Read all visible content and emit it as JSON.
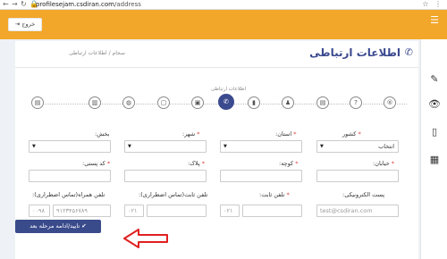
{
  "browser": {
    "url_host": "profilesejam.csdiran.com",
    "url_path": "/address",
    "back_icon": "arrow-left",
    "forward_icon": "arrow-right",
    "reload_icon": "reload",
    "lock_icon": "lock"
  },
  "header": {
    "exit_label": "خروج",
    "exit_icon": "sign-out"
  },
  "page": {
    "title": "اطلاعات ارتباطی",
    "breadcrumb": [
      "سجام",
      "اطلاعات ارتباطی"
    ],
    "breadcrumb_sep": "/"
  },
  "stepper": {
    "active_label": "اطلاعات ارتباطی",
    "steps": [
      "step-1",
      "step-2",
      "step-3",
      "step-4",
      "step-5",
      "step-6-active",
      "step-7",
      "step-8",
      "step-9",
      "step-10"
    ]
  },
  "form": {
    "country": {
      "label": "کشور",
      "value": "انتخاب"
    },
    "province": {
      "label": "استان:",
      "value": ""
    },
    "city": {
      "label": "شهر:",
      "value": ""
    },
    "section": {
      "label": "بخش:",
      "value": ""
    },
    "street": {
      "label": "خیابان:",
      "value": ""
    },
    "alley": {
      "label": "کوچه:",
      "value": ""
    },
    "plaque": {
      "label": "پلاک:",
      "value": ""
    },
    "postal_code": {
      "label": "کد پستی:",
      "value": ""
    },
    "email": {
      "label": "پست الکترونیکی:",
      "placeholder": "test@csdiran.com"
    },
    "phone": {
      "label": "تلفن ثابت:",
      "prefix": "۰۲۱",
      "value": ""
    },
    "emergency_phone": {
      "label": "تلفن ثابت(تماس اضطراری):",
      "prefix": "۰۲۱",
      "value": ""
    },
    "emergency_mobile": {
      "label": "تلفن همراه(تماس اضطراری):",
      "prefix": "۰۰۹۸",
      "placeholder": "۹۱۲۳۴۵۶۷۸۹"
    }
  },
  "submit": {
    "label": "تایید/ادامه مرحله بعد",
    "icon": "check"
  },
  "rail": [
    "menu-icon",
    "edit-icon",
    "eye-icon",
    "mobile-icon",
    "calculator-icon"
  ],
  "colors": {
    "header": "#f2a72b",
    "primary": "#3b4a8f",
    "required": "#e03a3a",
    "arrow": "#e02020"
  }
}
